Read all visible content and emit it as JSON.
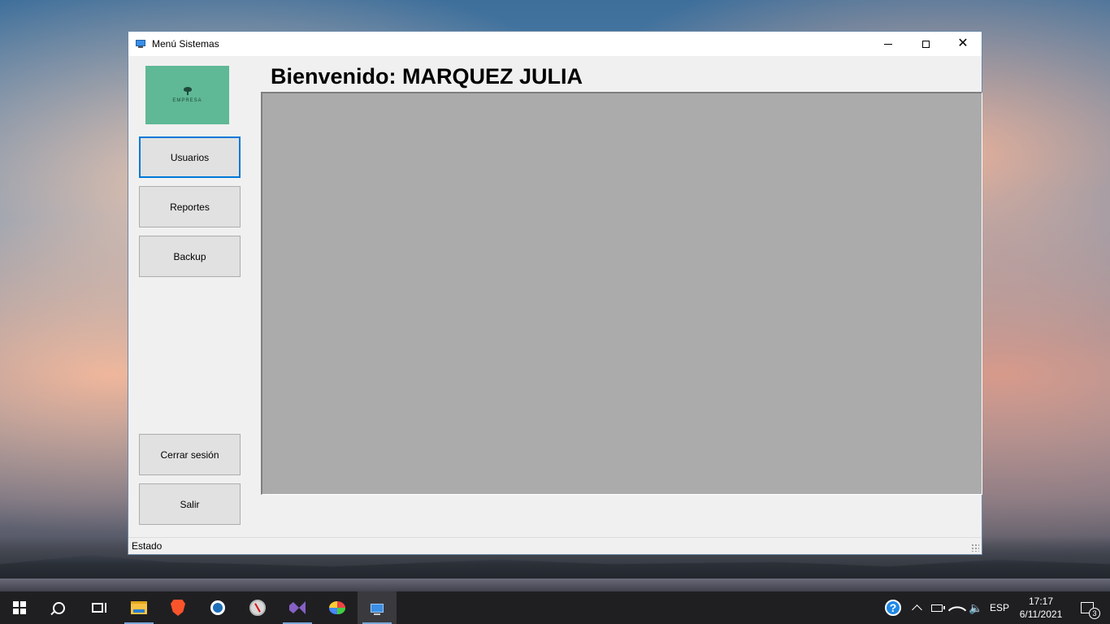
{
  "window": {
    "title": "Menú Sistemas",
    "controls": {
      "minimize": "minimize",
      "maximize": "maximize",
      "close": "✕"
    }
  },
  "logo": {
    "text": "EMPRESA"
  },
  "sidebar": {
    "buttons": [
      {
        "label": "Usuarios"
      },
      {
        "label": "Reportes"
      },
      {
        "label": "Backup"
      },
      {
        "label": "Cerrar sesión"
      },
      {
        "label": "Salir"
      }
    ]
  },
  "main": {
    "welcome": "Bienvenido: MARQUEZ JULIA"
  },
  "statusbar": {
    "text": "Estado"
  },
  "taskbar": {
    "apps": [
      "start-icon",
      "search-icon",
      "task-view-icon",
      "file-explorer-icon",
      "brave-icon",
      "ie-icon",
      "compass-icon",
      "visual-studio-icon",
      "paint-icon",
      "menu-sistemas-app-icon"
    ],
    "tray": {
      "help": "?",
      "language": "ESP",
      "time": "17:17",
      "date": "6/11/2021",
      "notification_count": "3"
    }
  }
}
